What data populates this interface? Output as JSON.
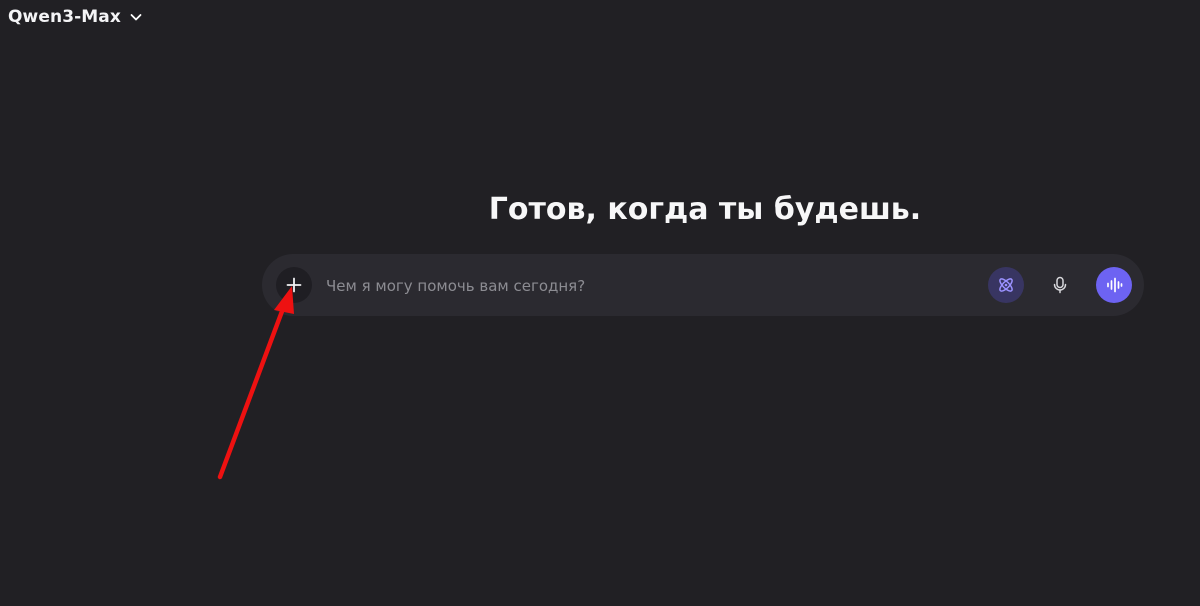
{
  "header": {
    "model_name": "Qwen3-Max",
    "dropdown_icon": "chevron-down-icon"
  },
  "main": {
    "greeting": "Готов, когда ты будешь."
  },
  "composer": {
    "placeholder": "Чем я могу помочь вам сегодня?",
    "value": "",
    "attach_icon": "plus-icon",
    "thinking_icon": "atom-icon",
    "mic_icon": "microphone-icon",
    "voice_icon": "sound-wave-icon"
  },
  "annotation": {
    "color": "#ee1111",
    "icon": "red-arrow-annotation"
  },
  "colors": {
    "background": "#212024",
    "composer": "#2b2a30",
    "accent": "#6d63f2",
    "thinking_button": "#383562"
  }
}
